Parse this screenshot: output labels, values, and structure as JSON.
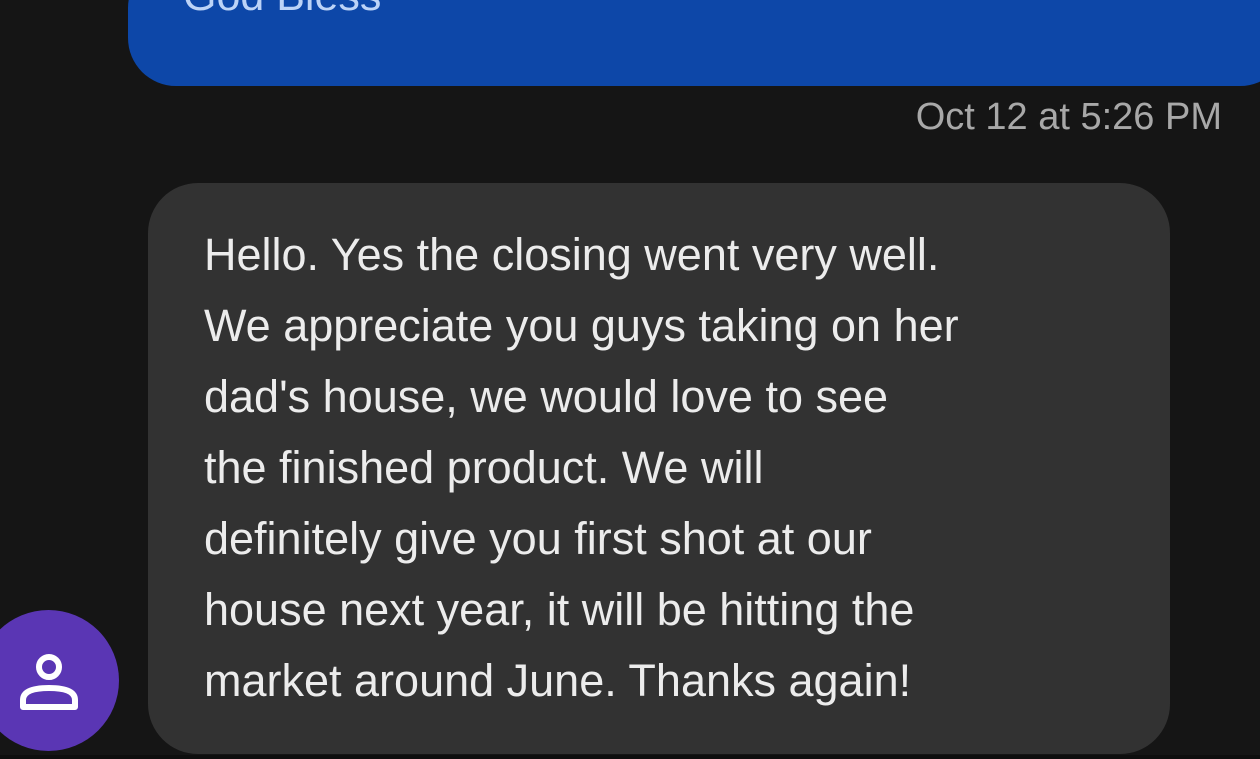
{
  "thread": {
    "sent_message": {
      "text": "God Bless",
      "bubble_color": "#0d47a8"
    },
    "timestamp": "Oct 12 at 5:26 PM",
    "received_message": {
      "text": "Hello. Yes the closing went very well.\nWe appreciate you guys taking on her\ndad's house, we would love to see\nthe finished product. We will\ndefinitely give you first shot at our\nhouse next year, it will be hitting the\nmarket around June. Thanks again!",
      "bubble_color": "#323232"
    },
    "avatar": {
      "icon": "person-icon",
      "color": "#5a36b4"
    }
  }
}
